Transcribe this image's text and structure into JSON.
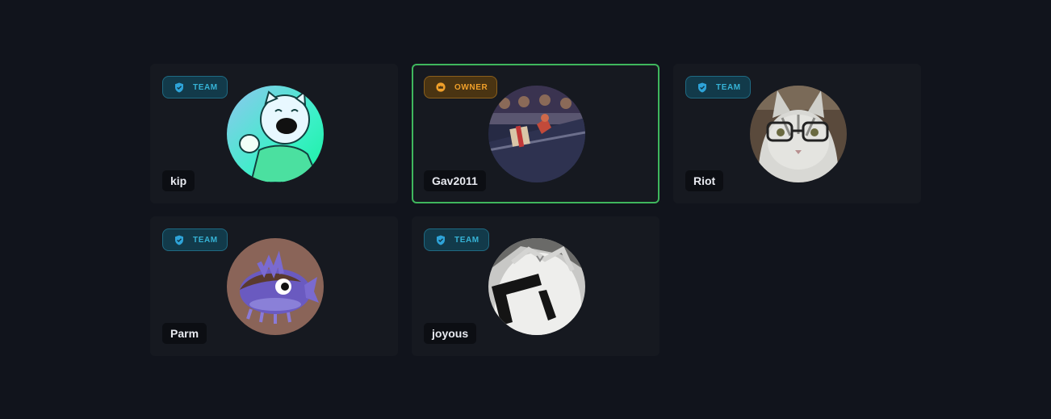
{
  "members": [
    {
      "name": "kip",
      "role": "TEAM",
      "role_icon": "shield-icon",
      "avatar": "cartoon-cat-hoodie-avatar"
    },
    {
      "name": "Gav2011",
      "role": "OWNER",
      "role_icon": "crown-icon",
      "avatar": "game-screenshot-avatar",
      "highlight_color": "#3fb65d"
    },
    {
      "name": "Riot",
      "role": "TEAM",
      "role_icon": "shield-icon",
      "avatar": "cat-with-glasses-avatar"
    },
    {
      "name": "Parm",
      "role": "TEAM",
      "role_icon": "shield-icon",
      "avatar": "purple-pufferfish-avatar"
    },
    {
      "name": "joyous",
      "role": "TEAM",
      "role_icon": "shield-icon",
      "avatar": "white-blocky-character-avatar"
    }
  ],
  "colors": {
    "background": "#11141c",
    "card": "#161920",
    "team_badge": "#36b3d6",
    "owner_badge": "#f0a02a",
    "owner_border": "#3fb65d"
  }
}
